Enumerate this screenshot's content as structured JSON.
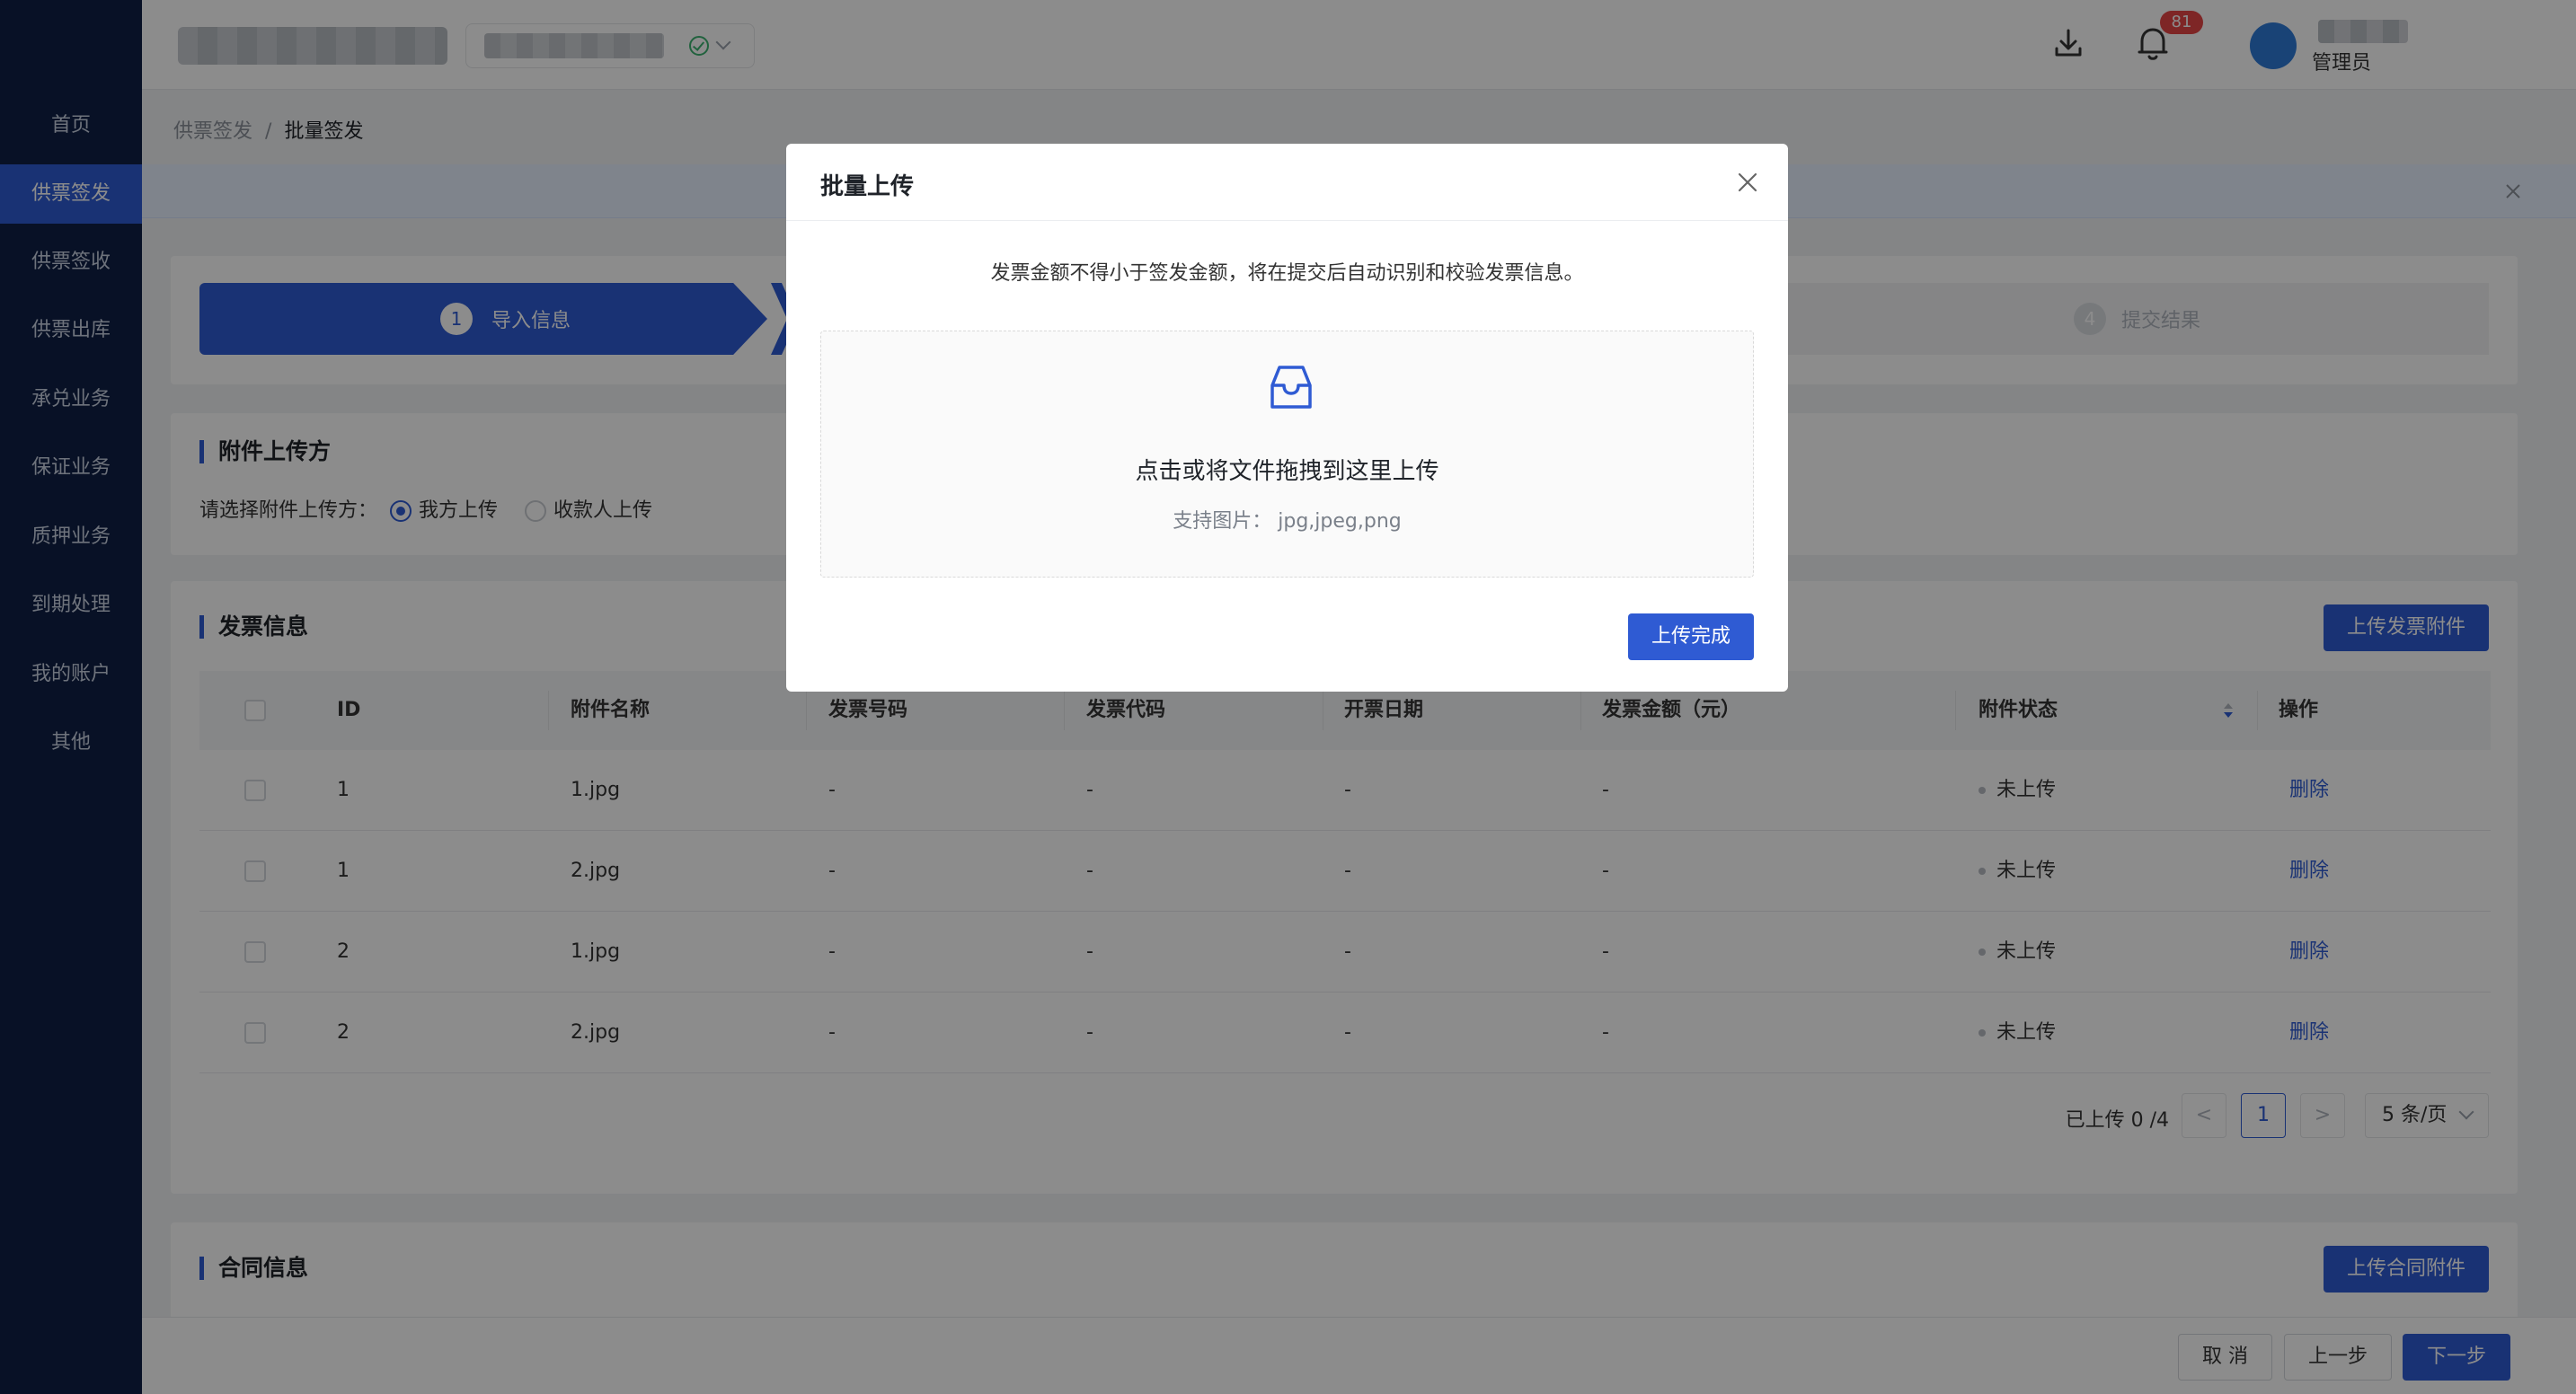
{
  "sidebar": {
    "items": [
      {
        "label": "首页"
      },
      {
        "label": "供票签发",
        "active": true
      },
      {
        "label": "供票签收"
      },
      {
        "label": "供票出库"
      },
      {
        "label": "承兑业务"
      },
      {
        "label": "保证业务"
      },
      {
        "label": "质押业务"
      },
      {
        "label": "到期处理"
      },
      {
        "label": "我的账户"
      },
      {
        "label": "其他"
      }
    ]
  },
  "header": {
    "notification_count": "81",
    "user_role": "管理员",
    "icons": [
      "download-icon",
      "bell-icon",
      "check-circle-icon",
      "chevron-down-icon"
    ]
  },
  "breadcrumb": {
    "parent": "供票签发",
    "separator": "/",
    "current": "批量签发"
  },
  "steps": [
    {
      "num": "1",
      "label": "导入信息",
      "state": "active"
    },
    {
      "num": "4",
      "label": "提交结果",
      "state": "pending"
    }
  ],
  "uploader_section": {
    "title": "附件上传方",
    "prompt": "请选择附件上传方：",
    "options": [
      {
        "label": "我方上传",
        "selected": true
      },
      {
        "label": "收款人上传",
        "selected": false
      }
    ]
  },
  "invoice_section": {
    "title": "发票信息",
    "upload_button": "上传发票附件",
    "columns": [
      "ID",
      "附件名称",
      "发票号码",
      "发票代码",
      "开票日期",
      "发票金额（元）",
      "附件状态",
      "操作"
    ],
    "rows": [
      {
        "id": "1",
        "name": "1.jpg",
        "number": "-",
        "code": "-",
        "date": "-",
        "amount": "-",
        "status": "未上传",
        "action": "删除"
      },
      {
        "id": "1",
        "name": "2.jpg",
        "number": "-",
        "code": "-",
        "date": "-",
        "amount": "-",
        "status": "未上传",
        "action": "删除"
      },
      {
        "id": "2",
        "name": "1.jpg",
        "number": "-",
        "code": "-",
        "date": "-",
        "amount": "-",
        "status": "未上传",
        "action": "删除"
      },
      {
        "id": "2",
        "name": "2.jpg",
        "number": "-",
        "code": "-",
        "date": "-",
        "amount": "-",
        "status": "未上传",
        "action": "删除"
      }
    ],
    "pagination": {
      "summary": "已上传 0 /4",
      "prev": "<",
      "current_page": "1",
      "next": ">",
      "page_size": "5 条/页"
    }
  },
  "contract_section": {
    "title": "合同信息",
    "upload_button": "上传合同附件"
  },
  "footer": {
    "cancel": "取 消",
    "prev": "上一步",
    "next": "下一步"
  },
  "modal": {
    "title": "批量上传",
    "tip": "发票金额不得小于签发金额，将在提交后自动识别和校验发票信息。",
    "drop_text": "点击或将文件拖拽到这里上传",
    "support_text": "支持图片：  jpg,jpeg,png",
    "confirm": "上传完成"
  },
  "colors": {
    "primary": "#2f5bd3",
    "sidebar_bg": "#0f1f45",
    "badge": "#e54545",
    "status_dot": "#b8bcc3"
  }
}
